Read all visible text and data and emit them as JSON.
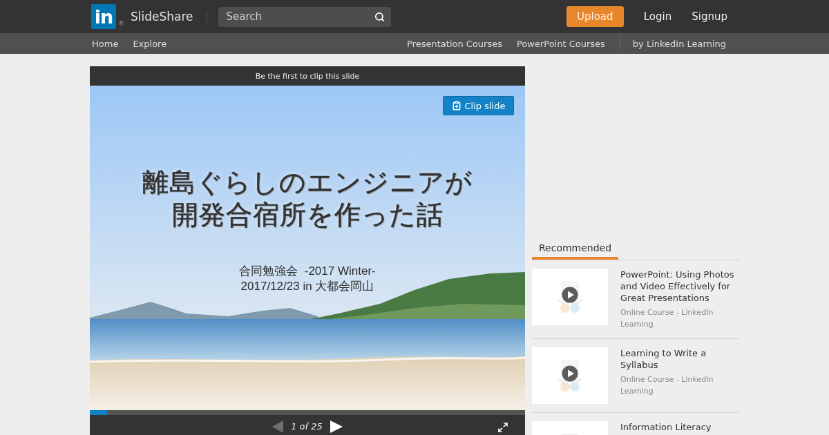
{
  "header": {
    "logo": {
      "mark": "in",
      "registered": "®"
    },
    "brand": "SlideShare",
    "search": {
      "placeholder": "Search"
    },
    "upload_button": "Upload",
    "links": [
      "Login",
      "Signup"
    ]
  },
  "subnav": {
    "left_links": [
      "Home",
      "Explore"
    ],
    "right_links": [
      "Presentation Courses",
      "PowerPoint Courses"
    ],
    "attribution": "by LinkedIn Learning"
  },
  "player": {
    "clip_banner": "Be the first to clip this slide",
    "clip_button": "Clip slide",
    "slide": {
      "title_lines": [
        "離島ぐらしのエンジニアが",
        "開発合宿所を作った話"
      ],
      "subtitle_lines": [
        "合同勉強会  -2017 Winter-",
        "2017/12/23 in 大都会岡山"
      ]
    },
    "progress": {
      "level": 0.04
    },
    "prev": {
      "disabled": true
    },
    "page_counter": "1 of 25",
    "next": {
      "disabled": false
    }
  },
  "sidebar": {
    "tabs": [
      {
        "label": "Recommended",
        "selected": true
      }
    ],
    "courses": [
      {
        "title": "PowerPoint: Using Photos and Video Effectively for Great Presentations",
        "meta": "Online Course - LinkedIn Learning"
      },
      {
        "title": "Learning to Write a Syllabus",
        "meta": "Online Course - LinkedIn Learning"
      },
      {
        "title": "Information Literacy"
      }
    ]
  }
}
